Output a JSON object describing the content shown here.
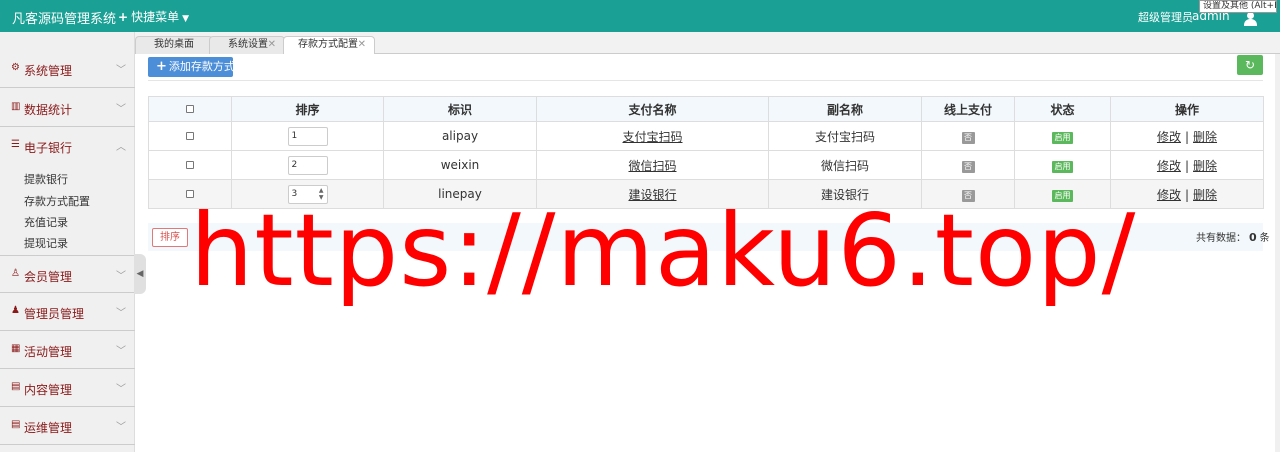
{
  "header": {
    "brand": "凡客源码管理系统",
    "quick_menu": "快捷菜单",
    "role": "超级管理员",
    "user": "admin",
    "tooltip": "设置及其他 (Alt+F)"
  },
  "sidebar": {
    "groups": [
      {
        "label": "系统管理",
        "icon": "gear-icon"
      },
      {
        "label": "数据统计",
        "icon": "chart-icon"
      },
      {
        "label": "电子银行",
        "icon": "list-icon"
      },
      {
        "label": "会员管理",
        "icon": "user-icon"
      },
      {
        "label": "管理员管理",
        "icon": "admin-icon"
      },
      {
        "label": "活动管理",
        "icon": "gift-icon"
      },
      {
        "label": "内容管理",
        "icon": "doc-icon"
      },
      {
        "label": "运维管理",
        "icon": "server-icon"
      }
    ],
    "subitems": [
      "提款银行",
      "存款方式配置",
      "充值记录",
      "提现记录"
    ]
  },
  "tabs": [
    {
      "label": "我的桌面"
    },
    {
      "label": "系统设置"
    },
    {
      "label": "存款方式配置"
    }
  ],
  "toolbar": {
    "add_label": "添加存款方式"
  },
  "table": {
    "headers": [
      "",
      "排序",
      "标识",
      "支付名称",
      "副名称",
      "线上支付",
      "状态",
      "操作"
    ],
    "rows": [
      {
        "sort": "1",
        "key": "alipay",
        "name": "支付宝扫码",
        "alias": "支付宝扫码",
        "online": "否",
        "status": "启用",
        "edit": "修改",
        "delete": "删除"
      },
      {
        "sort": "2",
        "key": "weixin",
        "name": "微信扫码",
        "alias": "微信扫码",
        "online": "否",
        "status": "启用",
        "edit": "修改",
        "delete": "删除"
      },
      {
        "sort": "3",
        "key": "linepay",
        "name": "建设银行",
        "alias": "建设银行",
        "online": "否",
        "status": "启用",
        "edit": "修改",
        "delete": "删除"
      }
    ],
    "sort_button": "排序",
    "total_label": "共有数据：",
    "total_count": "0",
    "total_unit": "条"
  },
  "watermark": "https://maku6.top/",
  "colors": {
    "topbar": "#1aa094",
    "primary": "#4c8ed7",
    "success": "#5cb85c",
    "menu_text": "#8a1a1a",
    "watermark": "#ff0000"
  }
}
